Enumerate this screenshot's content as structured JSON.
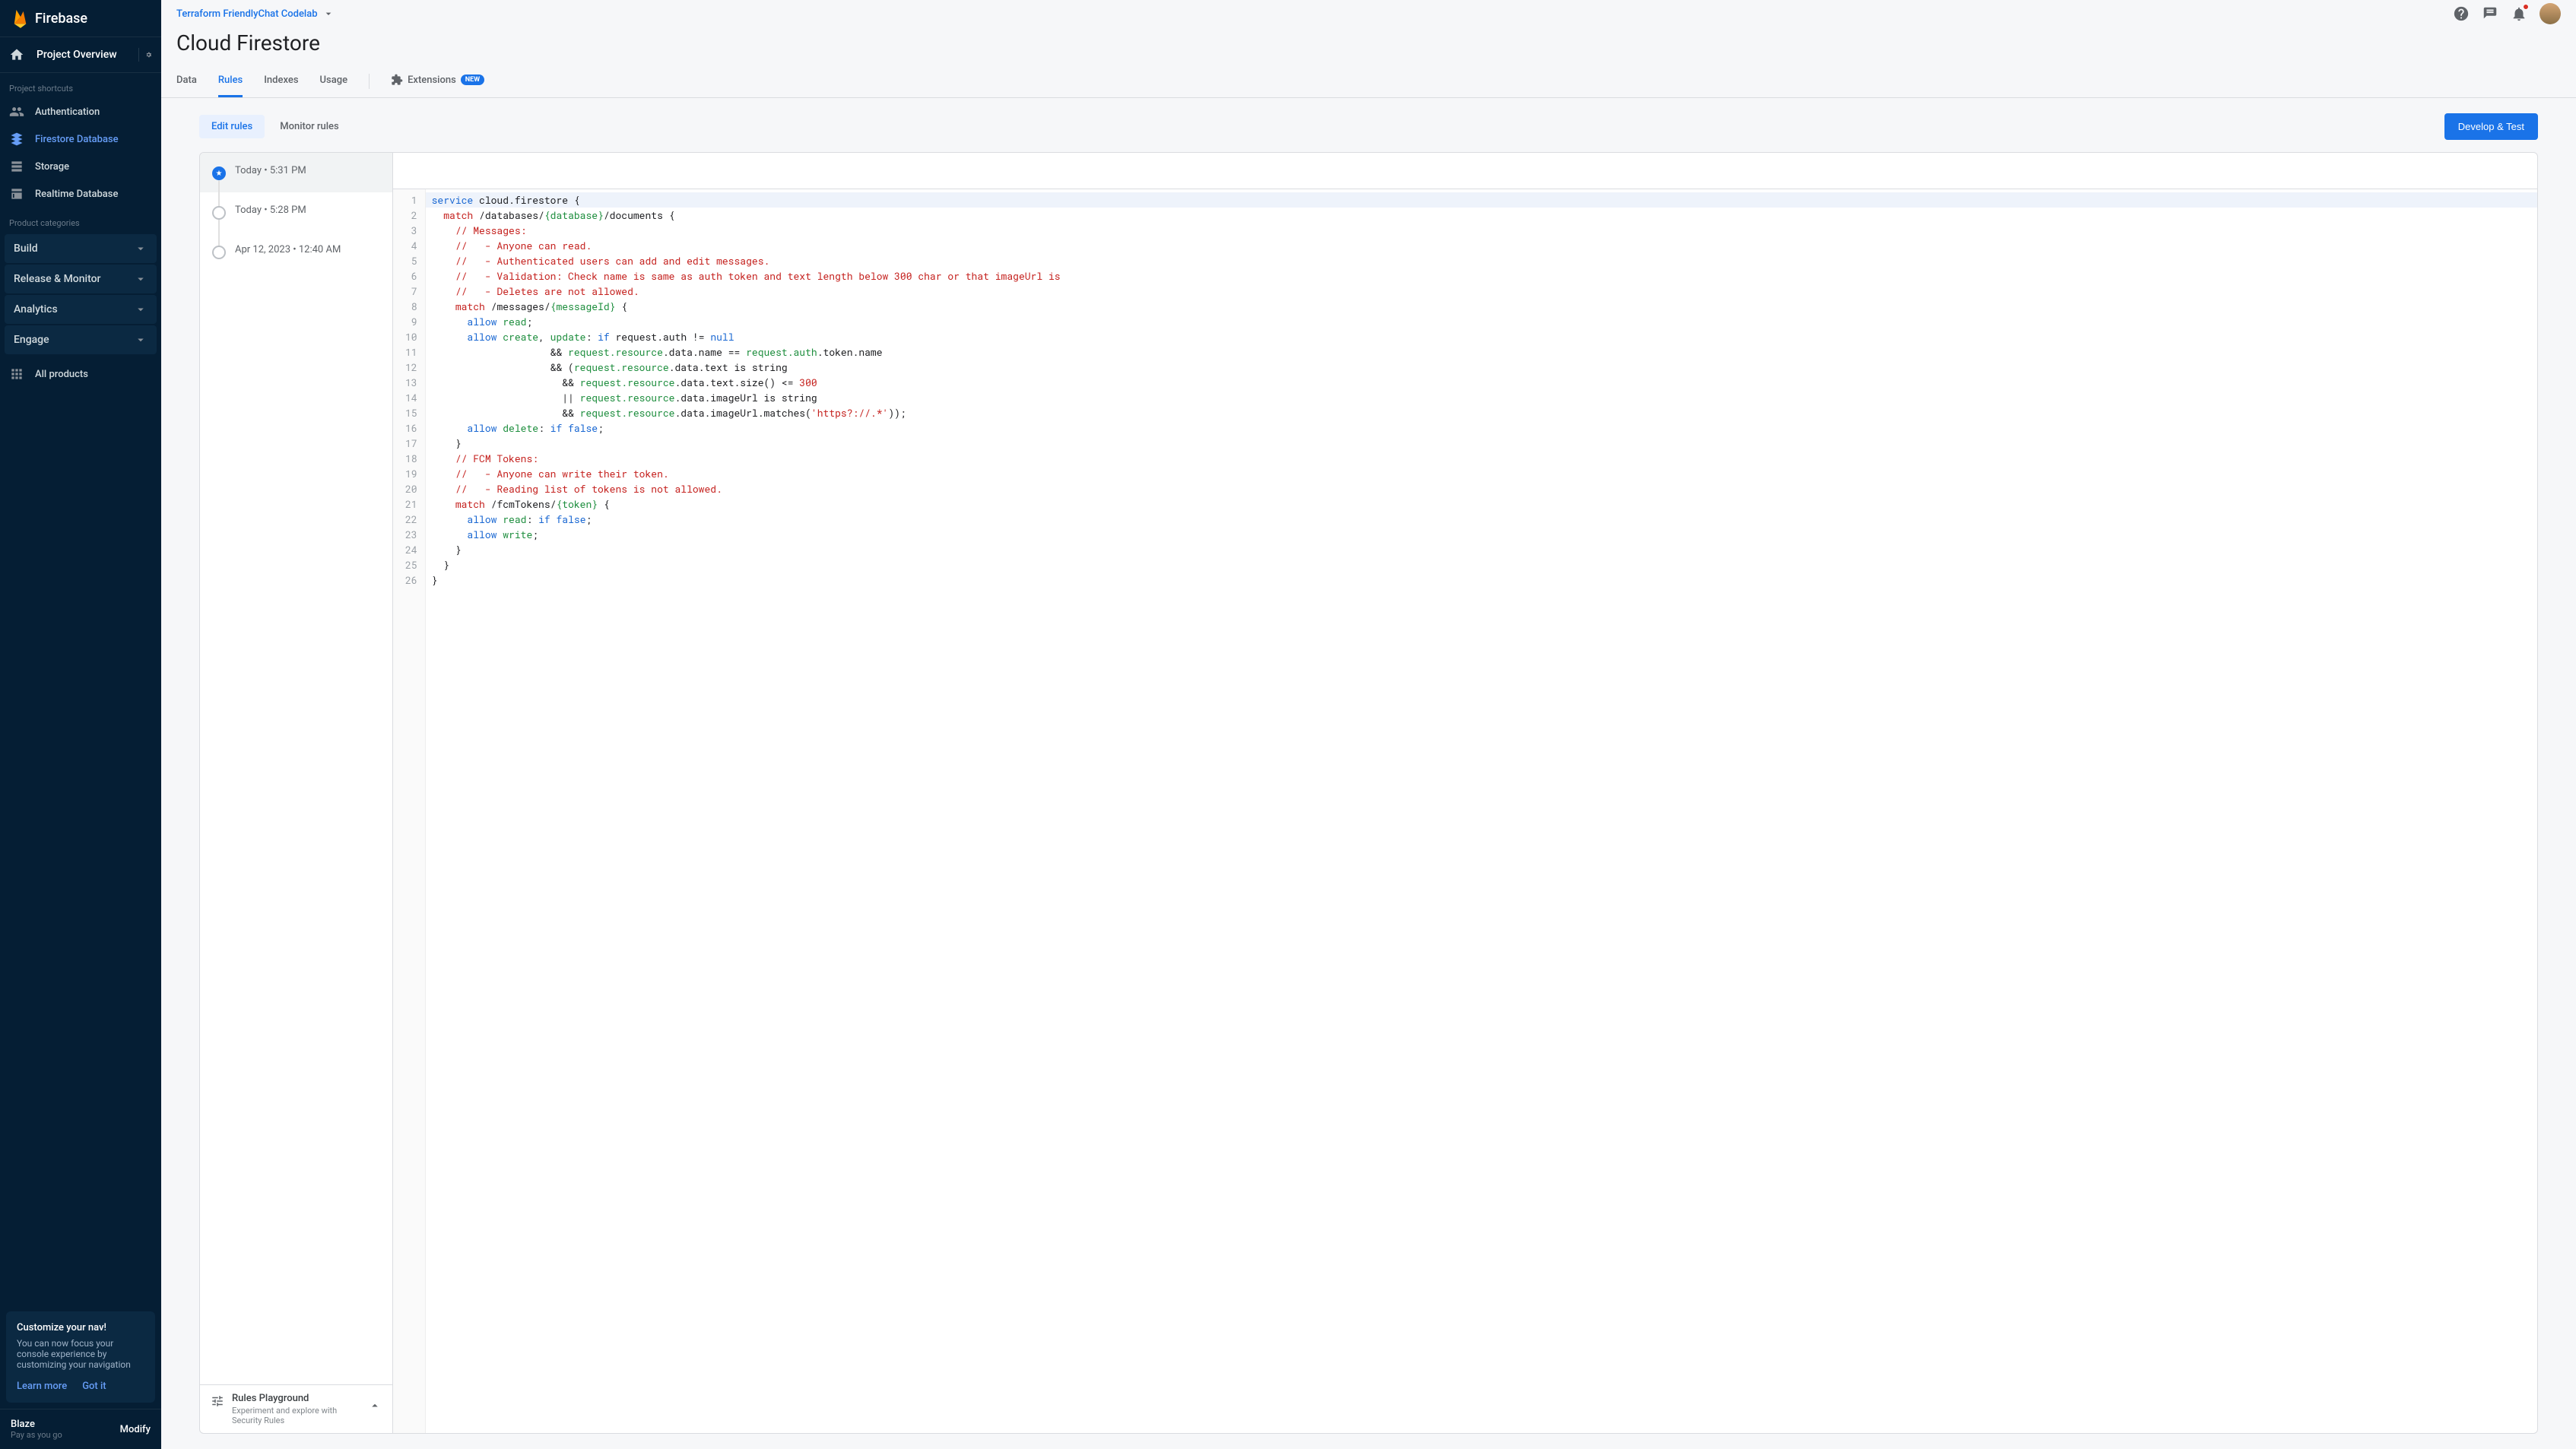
{
  "brand": "Firebase",
  "sidebar": {
    "overview": "Project Overview",
    "shortcuts_label": "Project shortcuts",
    "shortcuts": [
      {
        "label": "Authentication",
        "icon": "people-icon"
      },
      {
        "label": "Firestore Database",
        "icon": "firestore-icon",
        "active": true
      },
      {
        "label": "Storage",
        "icon": "storage-icon"
      },
      {
        "label": "Realtime Database",
        "icon": "database-icon"
      }
    ],
    "categories_label": "Product categories",
    "categories": [
      {
        "label": "Build"
      },
      {
        "label": "Release & Monitor"
      },
      {
        "label": "Analytics"
      },
      {
        "label": "Engage"
      }
    ],
    "all_products": "All products",
    "card": {
      "title": "Customize your nav!",
      "body": "You can now focus your console experience by customizing your navigation",
      "learn": "Learn more",
      "gotit": "Got it"
    },
    "plan": {
      "name": "Blaze",
      "desc": "Pay as you go",
      "modify": "Modify"
    }
  },
  "topbar": {
    "project": "Terraform FriendlyChat Codelab"
  },
  "page_title": "Cloud Firestore",
  "tabs": [
    {
      "label": "Data"
    },
    {
      "label": "Rules",
      "active": true
    },
    {
      "label": "Indexes"
    },
    {
      "label": "Usage"
    }
  ],
  "ext_tab": {
    "label": "Extensions",
    "badge": "NEW"
  },
  "rules": {
    "edit": "Edit rules",
    "monitor": "Monitor rules",
    "dev_test": "Develop & Test",
    "history": [
      {
        "label": "Today • 5:31 PM",
        "active": true
      },
      {
        "label": "Today • 5:28 PM"
      },
      {
        "label": "Apr 12, 2023 • 12:40 AM"
      }
    ],
    "playground": {
      "title": "Rules Playground",
      "desc": "Experiment and explore with Security Rules"
    }
  },
  "code": {
    "lines": [
      [
        [
          "kw",
          "service"
        ],
        [
          "p",
          " cloud.firestore {"
        ]
      ],
      [
        [
          "p",
          "  "
        ],
        [
          "kw2",
          "match"
        ],
        [
          "p",
          " /databases/"
        ],
        [
          "id",
          "{database}"
        ],
        [
          "p",
          "/documents {"
        ]
      ],
      [
        [
          "p",
          "    "
        ],
        [
          "cm",
          "// Messages:"
        ]
      ],
      [
        [
          "p",
          "    "
        ],
        [
          "cm",
          "//   - Anyone can read."
        ]
      ],
      [
        [
          "p",
          "    "
        ],
        [
          "cm",
          "//   - Authenticated users can add and edit messages."
        ]
      ],
      [
        [
          "p",
          "    "
        ],
        [
          "cm",
          "//   - Validation: Check name is same as auth token and text length below 300 char or that imageUrl is"
        ]
      ],
      [
        [
          "p",
          "    "
        ],
        [
          "cm",
          "//   - Deletes are not allowed."
        ]
      ],
      [
        [
          "p",
          "    "
        ],
        [
          "kw2",
          "match"
        ],
        [
          "p",
          " /messages/"
        ],
        [
          "id",
          "{messageId}"
        ],
        [
          "p",
          " {"
        ]
      ],
      [
        [
          "p",
          "      "
        ],
        [
          "allow",
          "allow"
        ],
        [
          "p",
          " "
        ],
        [
          "id",
          "read"
        ],
        [
          "p",
          ";"
        ]
      ],
      [
        [
          "p",
          "      "
        ],
        [
          "allow",
          "allow"
        ],
        [
          "p",
          " "
        ],
        [
          "id",
          "create"
        ],
        [
          "p",
          ", "
        ],
        [
          "id",
          "update"
        ],
        [
          "p",
          ": "
        ],
        [
          "kw",
          "if"
        ],
        [
          "p",
          " request.auth != "
        ],
        [
          "const",
          "null"
        ]
      ],
      [
        [
          "p",
          "                    && "
        ],
        [
          "id",
          "request.resource"
        ],
        [
          "p",
          ".data.name == "
        ],
        [
          "id",
          "request.auth"
        ],
        [
          "p",
          ".token.name"
        ]
      ],
      [
        [
          "p",
          "                    && ("
        ],
        [
          "id",
          "request.resource"
        ],
        [
          "p",
          ".data.text is string"
        ]
      ],
      [
        [
          "p",
          "                      && "
        ],
        [
          "id",
          "request.resource"
        ],
        [
          "p",
          ".data.text.size() <= "
        ],
        [
          "num",
          "300"
        ]
      ],
      [
        [
          "p",
          "                      || "
        ],
        [
          "id",
          "request.resource"
        ],
        [
          "p",
          ".data.imageUrl is string"
        ]
      ],
      [
        [
          "p",
          "                      && "
        ],
        [
          "id",
          "request.resource"
        ],
        [
          "p",
          ".data.imageUrl.matches("
        ],
        [
          "str",
          "'https?://.*'"
        ],
        [
          "p",
          "));"
        ]
      ],
      [
        [
          "p",
          "      "
        ],
        [
          "allow",
          "allow"
        ],
        [
          "p",
          " "
        ],
        [
          "id",
          "delete"
        ],
        [
          "p",
          ": "
        ],
        [
          "kw",
          "if"
        ],
        [
          "p",
          " "
        ],
        [
          "const",
          "false"
        ],
        [
          "p",
          ";"
        ]
      ],
      [
        [
          "p",
          "    }"
        ]
      ],
      [
        [
          "p",
          "    "
        ],
        [
          "cm",
          "// FCM Tokens:"
        ]
      ],
      [
        [
          "p",
          "    "
        ],
        [
          "cm",
          "//   - Anyone can write their token."
        ]
      ],
      [
        [
          "p",
          "    "
        ],
        [
          "cm",
          "//   - Reading list of tokens is not allowed."
        ]
      ],
      [
        [
          "p",
          "    "
        ],
        [
          "kw2",
          "match"
        ],
        [
          "p",
          " /fcmTokens/"
        ],
        [
          "id",
          "{token}"
        ],
        [
          "p",
          " {"
        ]
      ],
      [
        [
          "p",
          "      "
        ],
        [
          "allow",
          "allow"
        ],
        [
          "p",
          " "
        ],
        [
          "id",
          "read"
        ],
        [
          "p",
          ": "
        ],
        [
          "kw",
          "if"
        ],
        [
          "p",
          " "
        ],
        [
          "const",
          "false"
        ],
        [
          "p",
          ";"
        ]
      ],
      [
        [
          "p",
          "      "
        ],
        [
          "allow",
          "allow"
        ],
        [
          "p",
          " "
        ],
        [
          "id",
          "write"
        ],
        [
          "p",
          ";"
        ]
      ],
      [
        [
          "p",
          "    }"
        ]
      ],
      [
        [
          "p",
          "  }"
        ]
      ],
      [
        [
          "p",
          "}"
        ]
      ]
    ]
  }
}
